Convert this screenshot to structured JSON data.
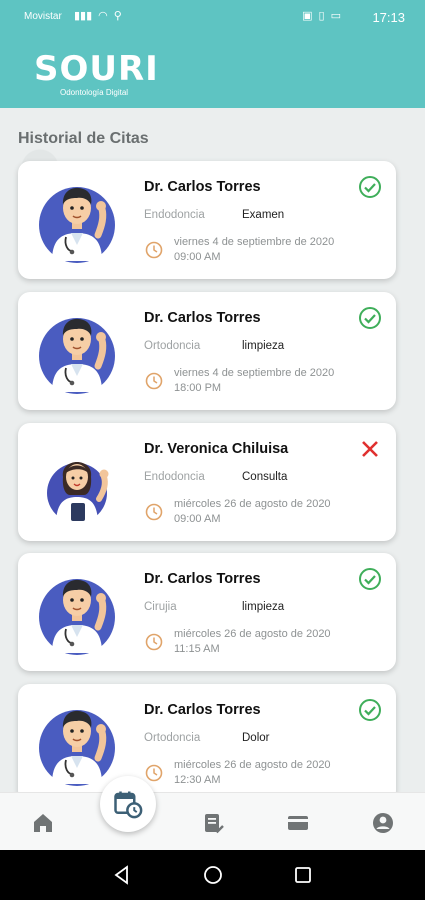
{
  "status_bar": {
    "carrier": "Movistar",
    "time": "17:13"
  },
  "app": {
    "brand": "SOURI",
    "tagline": "Odontología Digital"
  },
  "page": {
    "title": "Historial de Citas"
  },
  "appointments": [
    {
      "doctor": "Dr. Carlos Torres",
      "specialty": "Endodoncia",
      "reason": "Examen",
      "date": "viernes 4 de septiembre de 2020",
      "time": "09:00 AM",
      "status": "confirmed",
      "avatar": "male-doctor"
    },
    {
      "doctor": "Dr. Carlos Torres",
      "specialty": "Ortodoncia",
      "reason": "limpieza",
      "date": "viernes 4 de septiembre de 2020",
      "time": "18:00 PM",
      "status": "confirmed",
      "avatar": "male-doctor"
    },
    {
      "doctor": "Dr. Veronica Chiluisa",
      "specialty": "Endodoncia",
      "reason": "Consulta",
      "date": "miércoles 26 de agosto de 2020",
      "time": "09:00 AM",
      "status": "cancelled",
      "avatar": "female-doctor"
    },
    {
      "doctor": "Dr. Carlos Torres",
      "specialty": "Cirujia",
      "reason": "limpieza",
      "date": "miércoles 26 de agosto de 2020",
      "time": "11:15 AM",
      "status": "confirmed",
      "avatar": "male-doctor"
    },
    {
      "doctor": "Dr. Carlos Torres",
      "specialty": "Ortodoncia",
      "reason": "Dolor",
      "date": "miércoles 26 de agosto de 2020",
      "time": "12:30 AM",
      "status": "confirmed",
      "avatar": "male-doctor"
    }
  ],
  "bottom_nav": {
    "items": [
      "home-icon",
      "calendar-clock-icon",
      "checklist-icon",
      "credit-card-icon",
      "user-icon"
    ],
    "active": "calendar-clock-icon"
  },
  "colors": {
    "primary": "#5ec4c2",
    "confirmed": "#3fae5a",
    "cancelled": "#e0302f",
    "clock": "#e0a46a"
  }
}
